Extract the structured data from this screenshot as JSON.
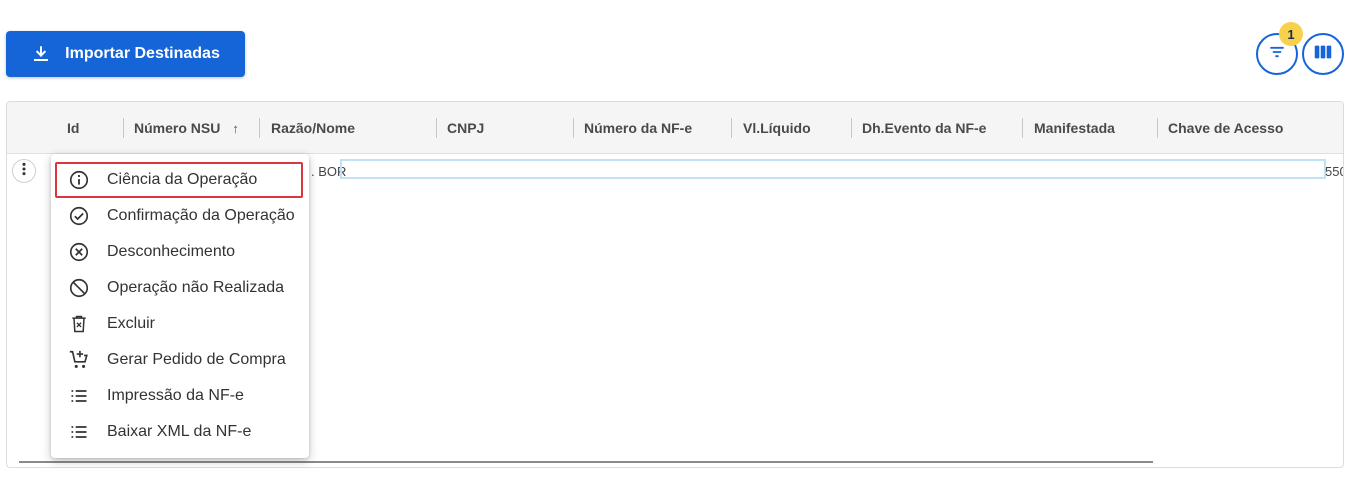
{
  "toolbar": {
    "import_label": "Importar Destinadas",
    "filter_badge": "1"
  },
  "grid": {
    "columns": [
      {
        "label": "Id"
      },
      {
        "label": "Número NSU",
        "sort": "↑"
      },
      {
        "label": "Razão/Nome"
      },
      {
        "label": "CNPJ"
      },
      {
        "label": "Número da NF-e"
      },
      {
        "label": "Vl.Líquido"
      },
      {
        "label": "Dh.Evento da NF-e"
      },
      {
        "label": "Manifestada"
      },
      {
        "label": "Chave de Acesso"
      }
    ],
    "row": {
      "razao_partial": ". BOR",
      "chave_partial": "550"
    }
  },
  "context_menu": {
    "items": [
      {
        "label": "Ciência da Operação",
        "icon": "info-icon",
        "selected": true
      },
      {
        "label": "Confirmação da Operação",
        "icon": "check-circle-icon"
      },
      {
        "label": "Desconhecimento",
        "icon": "cancel-circle-icon"
      },
      {
        "label": "Operação não Realizada",
        "icon": "block-icon"
      },
      {
        "label": "Excluir",
        "icon": "delete-icon"
      },
      {
        "label": "Gerar Pedido de Compra",
        "icon": "add-cart-icon"
      },
      {
        "label": "Impressão da NF-e",
        "icon": "list-icon"
      },
      {
        "label": "Baixar XML da NF-e",
        "icon": "list-icon"
      }
    ]
  },
  "colors": {
    "primary": "#1565d8",
    "badge": "#f7d14b",
    "selected_outline": "#d9363e",
    "row_highlight": "#bfe3f2"
  }
}
